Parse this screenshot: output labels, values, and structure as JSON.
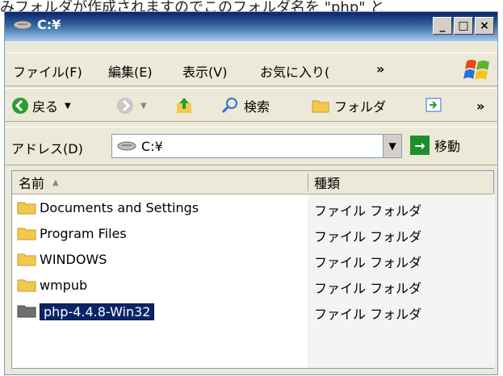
{
  "top_caption": "みフォルダが作成されますのでこのフォルダ名を \"php\" と",
  "window": {
    "title": "C:¥",
    "buttons": [
      "_",
      "□",
      "×"
    ]
  },
  "menu": [
    {
      "label": "ファイル(F)"
    },
    {
      "label": "編集(E)"
    },
    {
      "label": "表示(V)"
    },
    {
      "label": "お気に入り("
    },
    {
      "label": "»"
    }
  ],
  "toolbar": {
    "back": "戻る",
    "search": "検索",
    "folders": "フォルダ",
    "more": "»"
  },
  "address": {
    "label": "アドレス(D)",
    "value": "C:¥",
    "go": "移動"
  },
  "list": {
    "headers": [
      "名前",
      "種類"
    ],
    "rows": [
      {
        "name": "Documents and Settings",
        "type": "ファイル フォルダ"
      },
      {
        "name": "Program Files",
        "type": "ファイル フォルダ"
      },
      {
        "name": "WINDOWS",
        "type": "ファイル フォルダ"
      },
      {
        "name": "wmpub",
        "type": "ファイル フォルダ"
      },
      {
        "name": "php-4.4.8-Win32",
        "type": "ファイル フォルダ"
      }
    ]
  }
}
